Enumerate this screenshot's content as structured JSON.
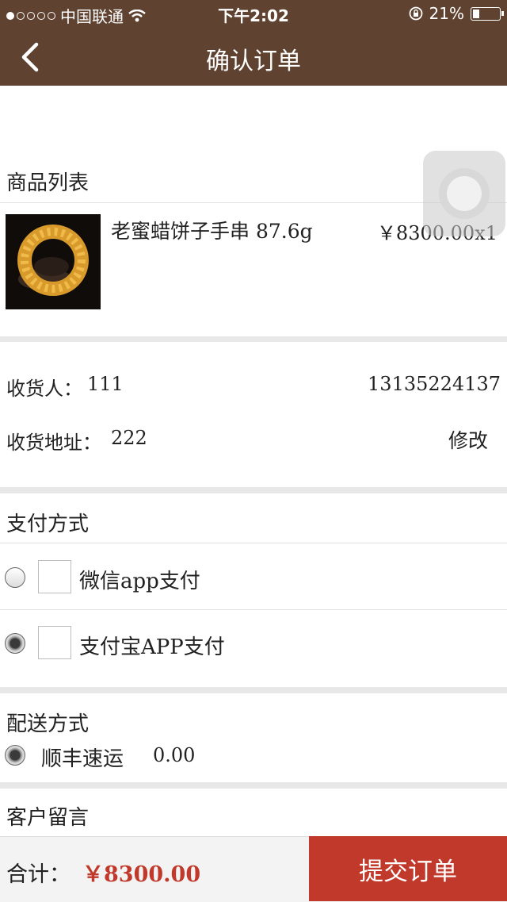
{
  "status_bar": {
    "carrier": "中国联通",
    "time": "下午2:02",
    "battery": "21%"
  },
  "nav": {
    "title": "确认订单"
  },
  "product_section": {
    "heading": "商品列表",
    "item": {
      "name": "老蜜蜡饼子手串 87.6g",
      "price_qty": "￥8300.00x1"
    }
  },
  "shipping_info": {
    "receiver_label": "收货人：",
    "receiver_value": "111",
    "phone": "13135224137",
    "address_label": "收货地址：",
    "address_value": "222",
    "edit_label": "修改"
  },
  "payment": {
    "heading": "支付方式",
    "options": [
      {
        "label": "微信app支付",
        "selected": false
      },
      {
        "label": "支付宝APP支付",
        "selected": true
      }
    ]
  },
  "delivery": {
    "heading": "配送方式",
    "option_label": "顺丰速运",
    "option_price": "0.00",
    "selected": true
  },
  "message": {
    "heading": "客户留言"
  },
  "footer": {
    "total_label": "合计：",
    "total_value": "￥8300.00",
    "submit_label": "提交订单"
  },
  "colors": {
    "nav_bg": "#5f4230",
    "accent_red": "#c0392b"
  }
}
